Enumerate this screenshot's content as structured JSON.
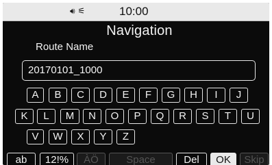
{
  "status_bar": {
    "audio_icon": "speaker-icon",
    "antenna_icon": "signal-icon",
    "time": "10:00"
  },
  "screen": {
    "title": "Navigation",
    "field_label": "Route Name",
    "field_value": "20170101_1000"
  },
  "keyboard": {
    "row1": [
      "A",
      "B",
      "C",
      "D",
      "E",
      "F",
      "G",
      "H",
      "I",
      "J"
    ],
    "row2": [
      "K",
      "L",
      "M",
      "N",
      "O",
      "P",
      "Q",
      "R",
      "S",
      "T",
      "U"
    ],
    "row3": [
      "V",
      "W",
      "X",
      "Y",
      "Z"
    ]
  },
  "bottom_bar": {
    "ab": "ab",
    "symbols": "12!%",
    "accents": "ÀÖ",
    "space": "Space",
    "del": "Del",
    "ok": "OK",
    "skip": "Skip"
  },
  "colors": {
    "background": "#0b0b0b",
    "text": "#f2f2f2",
    "disabled": "#555555",
    "ok_highlight": "#eaeaea"
  }
}
